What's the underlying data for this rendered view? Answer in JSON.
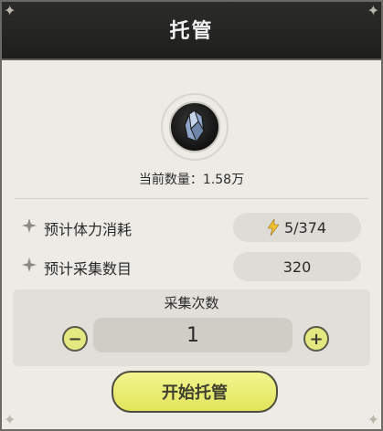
{
  "dialog": {
    "title": "托管",
    "current_quantity": "当前数量：1.58万"
  },
  "stats": [
    {
      "label": "预计体力消耗",
      "value": "5/374",
      "icon": "lightning-bolt-icon"
    },
    {
      "label": "预计采集数目",
      "value": "320"
    }
  ],
  "collect": {
    "title": "采集次数",
    "count": "1",
    "minus": "−",
    "plus": "+"
  },
  "actions": {
    "start_label": "开始托管"
  },
  "colors": {
    "header": "#1e1e1c",
    "panel": "#ecebe6",
    "accent_button": "#e8eb6a"
  }
}
